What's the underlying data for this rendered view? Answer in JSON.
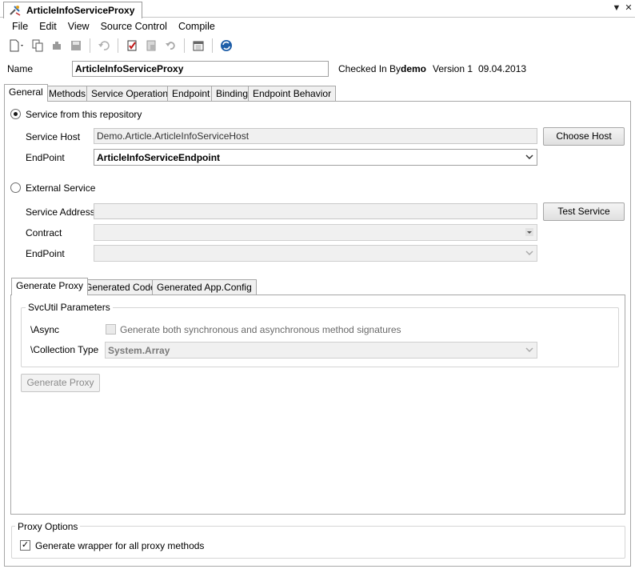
{
  "doc_tab": {
    "title": "ArticleInfoServiceProxy"
  },
  "menu": [
    "File",
    "Edit",
    "View",
    "Source Control",
    "Compile"
  ],
  "toolbar": {
    "icons": [
      "new-icon",
      "copy-icon",
      "plugin-icon",
      "save-icon",
      "undo-icon",
      "checkin-icon",
      "checkout-icon",
      "revert-icon",
      "calendar-icon",
      "refresh-icon"
    ]
  },
  "name_row": {
    "label": "Name",
    "value": "ArticleInfoServiceProxy",
    "checked_in_by_label": "Checked In By",
    "checked_in_by_user": "demo",
    "version": "Version 1",
    "date": "09.04.2013"
  },
  "tabs": [
    "General",
    "Methods",
    "Service Operations",
    "Endpoint",
    "Binding",
    "Endpoint Behavior"
  ],
  "general": {
    "repo_radio_label": "Service from this repository",
    "service_host_label": "Service Host",
    "service_host_value": "Demo.Article.ArticleInfoServiceHost",
    "choose_host_label": "Choose Host",
    "endpoint_label": "EndPoint",
    "endpoint_value": "ArticleInfoServiceEndpoint",
    "external_radio_label": "External Service",
    "service_address_label": "Service Address",
    "test_service_label": "Test Service",
    "contract_label": "Contract",
    "ext_endpoint_label": "EndPoint"
  },
  "sub_tabs": [
    "Generate Proxy",
    "Generated Code",
    "Generated App.Config"
  ],
  "svcutil": {
    "group_title": "SvcUtil Parameters",
    "async_label": "\\Async",
    "async_checkbox_label": "Generate both synchronous and asynchronous method signatures",
    "collection_type_label": "\\Collection Type",
    "collection_type_value": "System.Array",
    "generate_button": "Generate Proxy"
  },
  "proxy_options": {
    "group_title": "Proxy Options",
    "wrapper_label": "Generate wrapper for all proxy methods"
  }
}
